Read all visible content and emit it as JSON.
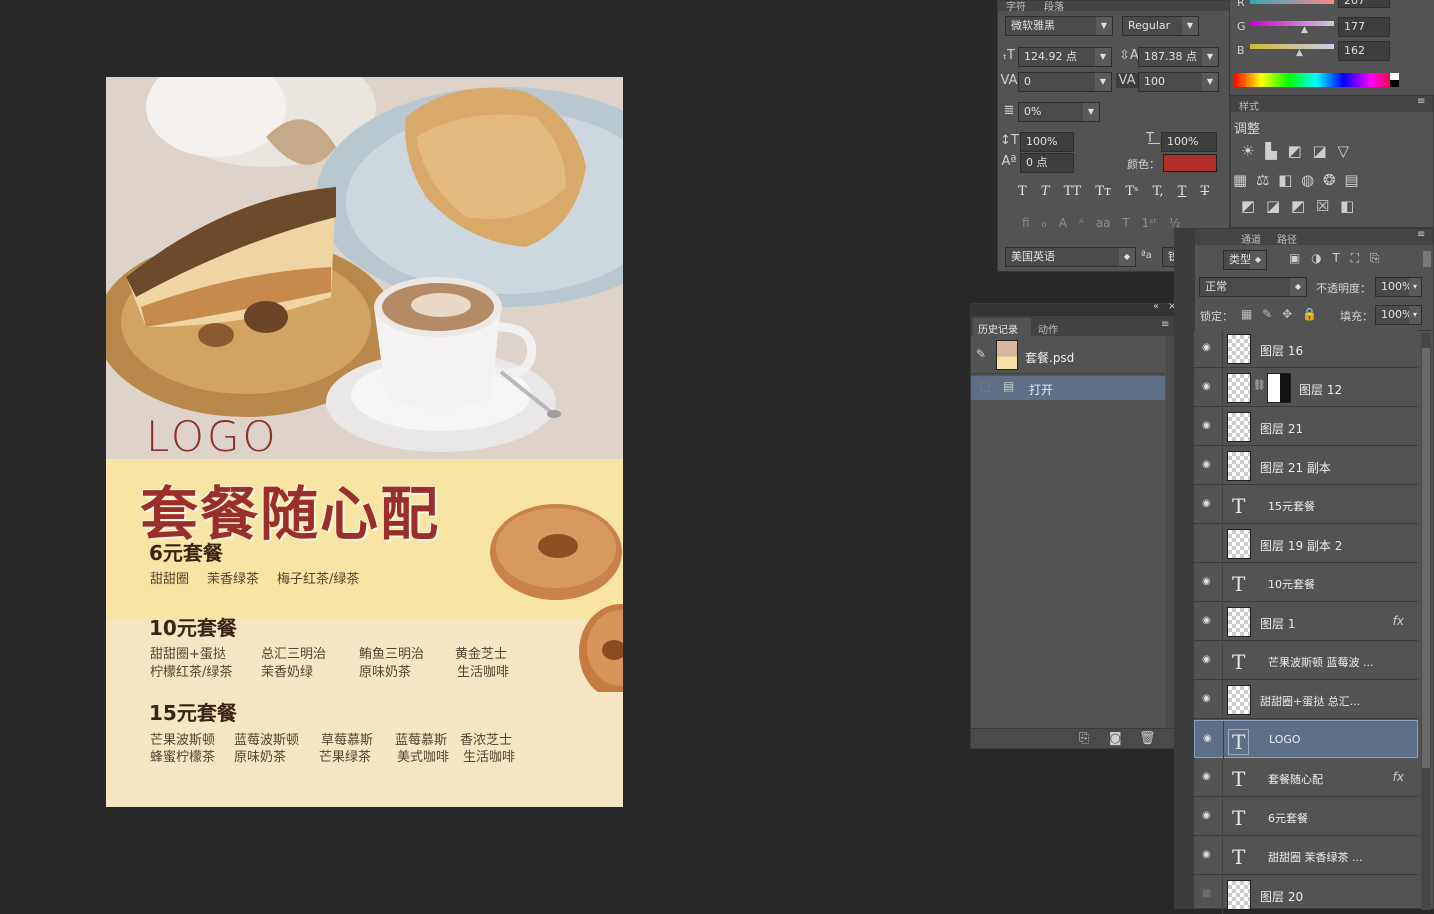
{
  "character_panel": {
    "tab_character": "字符",
    "tab_paragraph": "段落",
    "font_family": "微软雅黑",
    "font_style": "Regular",
    "font_size": "124.92 点",
    "leading": "187.38 点",
    "kerning": "0",
    "tracking": "100",
    "scale_tsume": "0%",
    "vertical_scale": "100%",
    "horizontal_scale": "100%",
    "baseline_shift": "0 点",
    "color_label": "颜色：",
    "color_value": "#b3302a",
    "language": "美国英语",
    "antialias_label": "ªa",
    "antialias": "锐利"
  },
  "color_panel": {
    "r_label": "R",
    "r_value": "207",
    "g_label": "G",
    "g_value": "177",
    "b_label": "B",
    "b_value": "162"
  },
  "adjust_panel": {
    "tab_styles": "样式",
    "title": "调整"
  },
  "history_panel": {
    "tab_history": "历史记录",
    "tab_actions": "动作",
    "snapshot": "套餐.psd",
    "step_open": "打开"
  },
  "layers_panel": {
    "tab_channels": "通道",
    "tab_paths": "路径",
    "filter_kind": "类型",
    "blend_mode": "正常",
    "opacity_label": "不透明度：",
    "opacity": "100%",
    "lock_label": "锁定：",
    "fill_label": "填充：",
    "fill": "100%",
    "layers": [
      {
        "name": "图层 16",
        "type": "pixel",
        "visible": true
      },
      {
        "name": "图层 12",
        "type": "mask",
        "visible": true
      },
      {
        "name": "图层 21",
        "type": "pixel",
        "visible": true
      },
      {
        "name": "图层 21 副本",
        "type": "pixel",
        "visible": true
      },
      {
        "name": "15元套餐",
        "type": "text",
        "visible": true
      },
      {
        "name": "图层 19 副本 2",
        "type": "pixel",
        "visible": false
      },
      {
        "name": "10元套餐",
        "type": "text",
        "visible": true
      },
      {
        "name": "图层 1",
        "type": "pixel",
        "visible": true,
        "fx": "fx"
      },
      {
        "name": "芒果波斯顿    蓝莓波 ...",
        "type": "text",
        "visible": true
      },
      {
        "name": "甜甜圈+蛋挞        总汇...",
        "type": "pixel",
        "visible": true
      },
      {
        "name": "LOGO",
        "type": "text",
        "visible": true,
        "selected": true
      },
      {
        "name": "套餐随心配",
        "type": "text",
        "visible": true,
        "fx": "fx"
      },
      {
        "name": "6元套餐",
        "type": "text",
        "visible": true
      },
      {
        "name": "甜甜圈    茉香绿茶    ...",
        "type": "text",
        "visible": true
      },
      {
        "name": "图层 20",
        "type": "pixel",
        "visible": false
      }
    ]
  },
  "poster": {
    "logo": "LOGO",
    "headline": "套餐随心配",
    "sections": [
      {
        "title": "6元套餐",
        "rows": [
          [
            "甜甜圈",
            "茉香绿茶",
            "梅子红茶/绿茶"
          ]
        ]
      },
      {
        "title": "10元套餐",
        "rows": [
          [
            "甜甜圈+蛋挞",
            "总汇三明治",
            "鲔鱼三明治",
            "黄金芝士"
          ],
          [
            "柠檬红茶/绿茶",
            "茉香奶绿",
            "原味奶茶",
            "生活咖啡"
          ]
        ]
      },
      {
        "title": "15元套餐",
        "rows": [
          [
            "芒果波斯顿",
            "蓝莓波斯顿",
            "草莓慕斯",
            "蓝莓慕斯",
            "香浓芝士"
          ],
          [
            "蜂蜜柠檬茶",
            "原味奶茶",
            "芒果绿茶",
            "美式咖啡",
            "生活咖啡"
          ]
        ]
      }
    ]
  }
}
